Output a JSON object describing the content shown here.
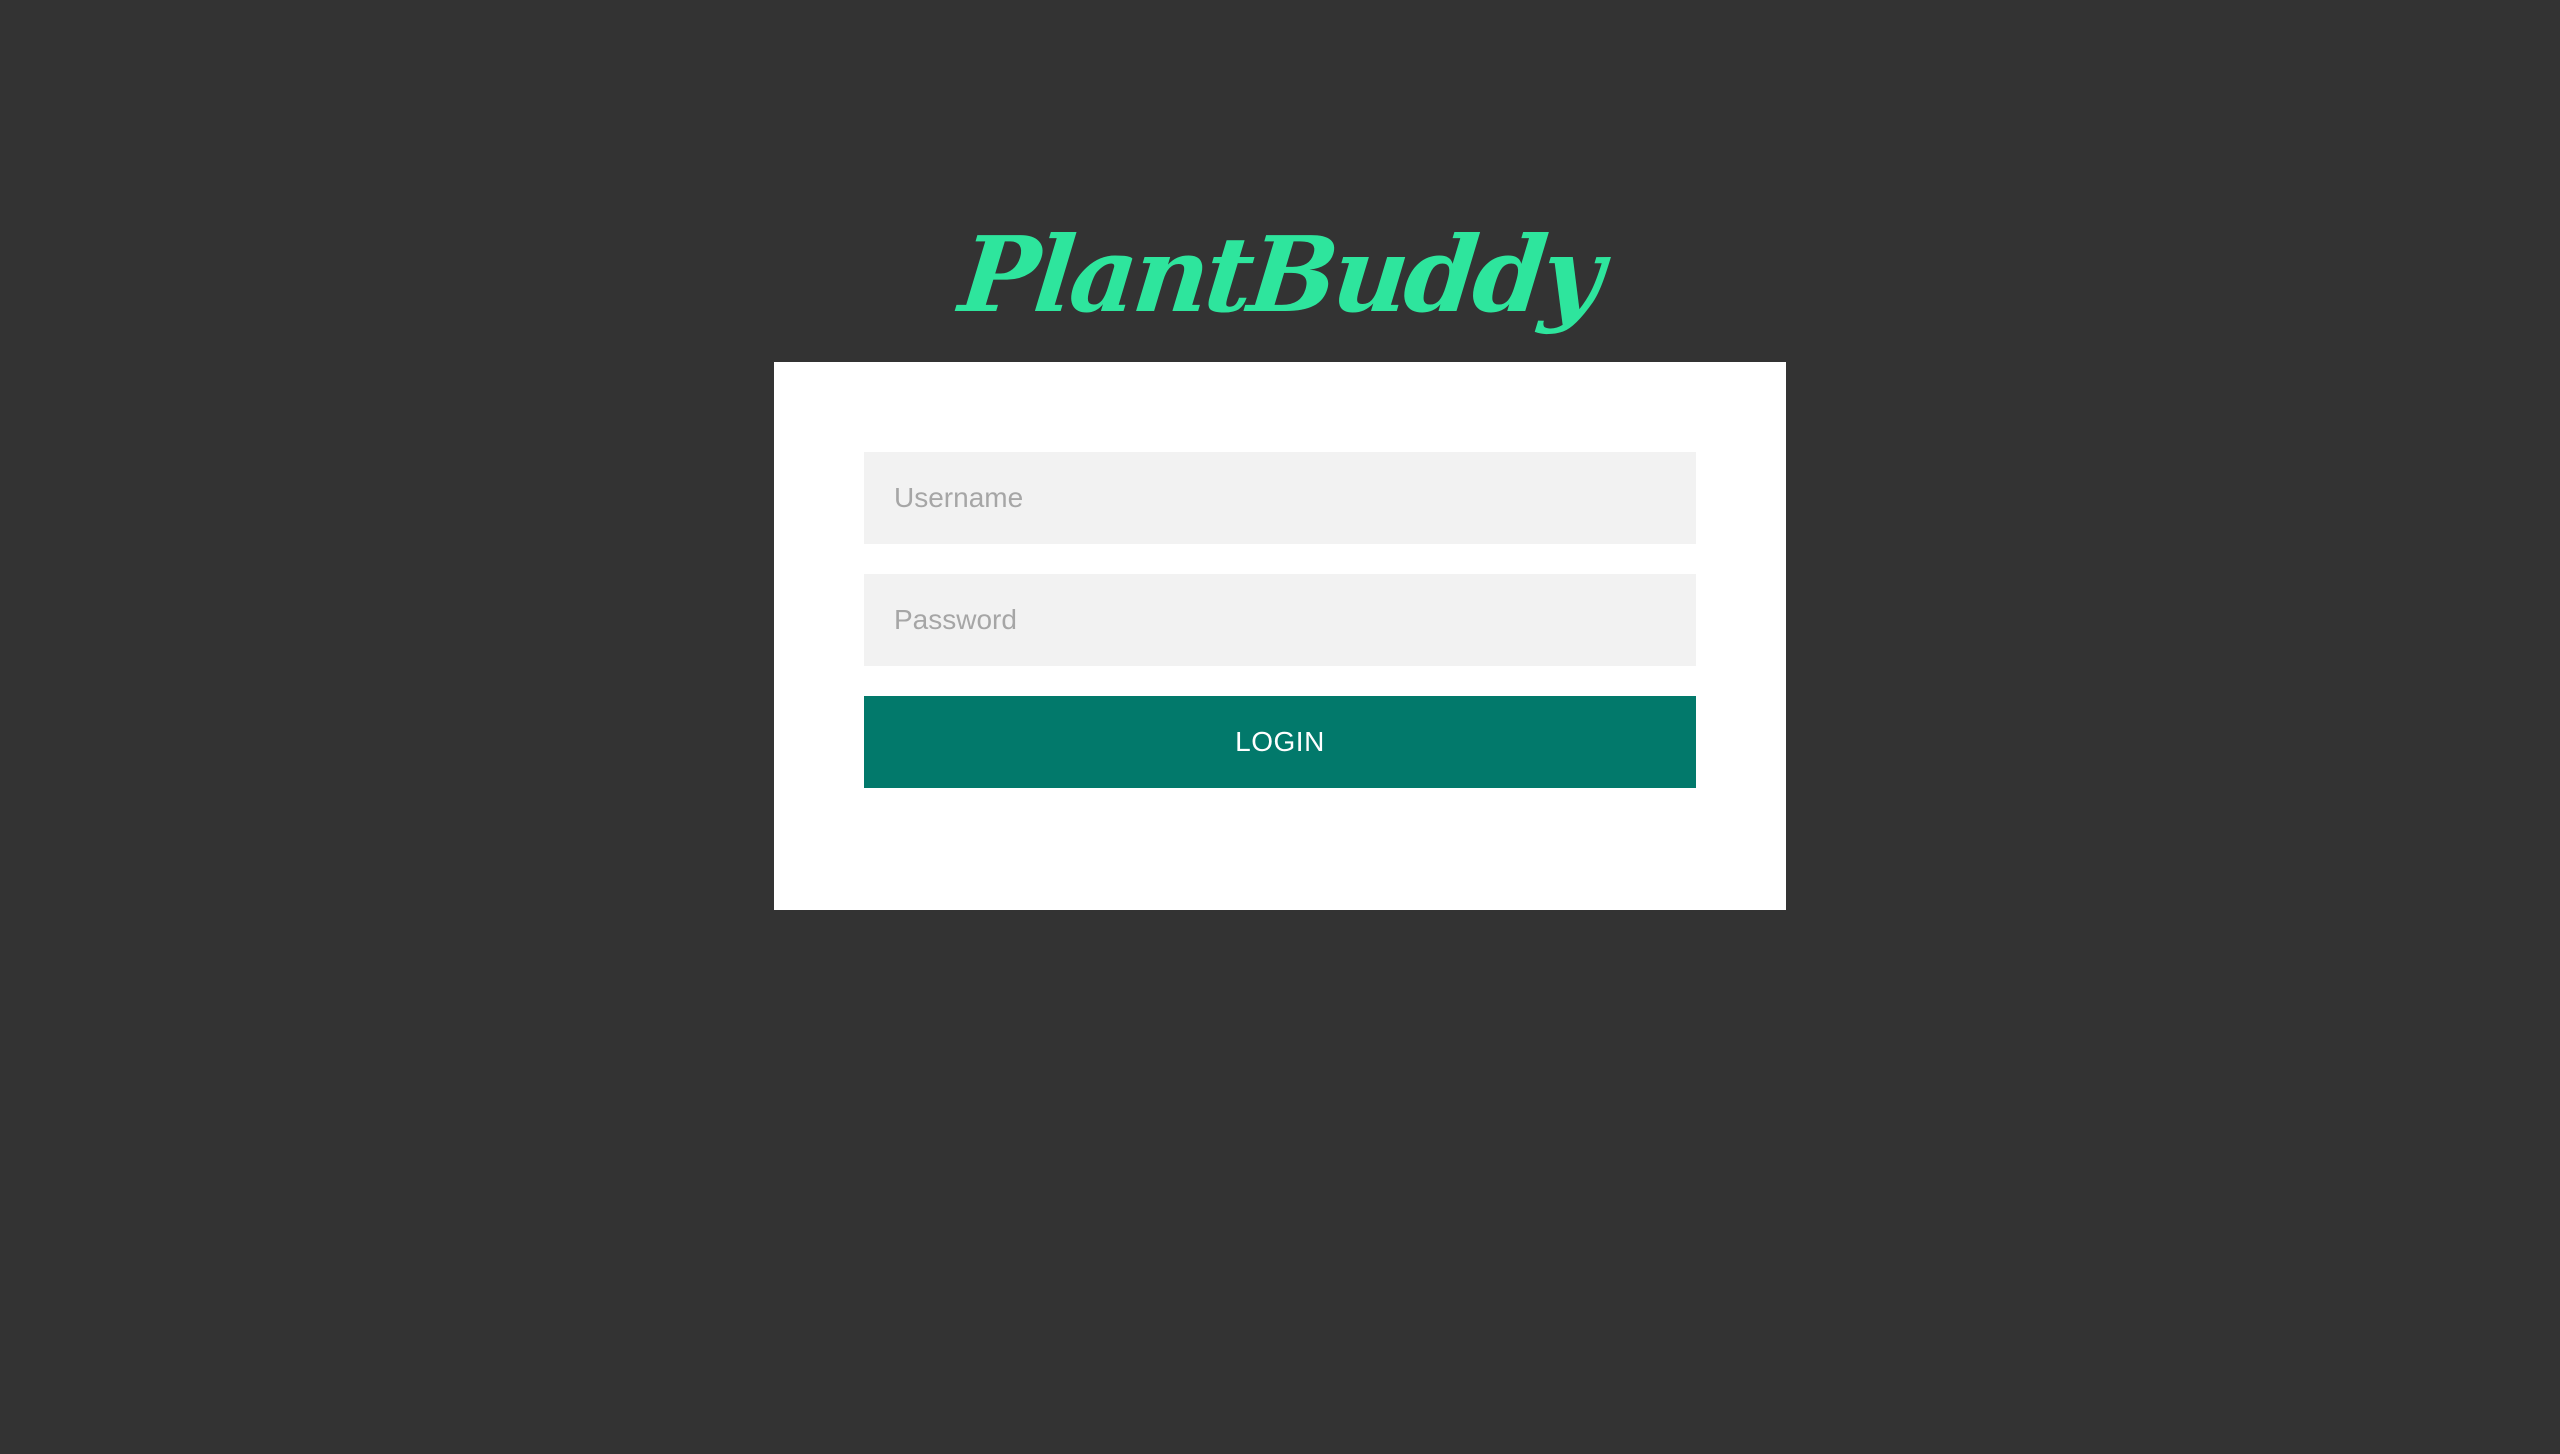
{
  "brand": {
    "logo_text": "PlantBuddy",
    "logo_color": "#2ee59d"
  },
  "login_form": {
    "username_placeholder": "Username",
    "username_value": "",
    "password_placeholder": "Password",
    "password_value": "",
    "login_label": "LOGIN"
  },
  "colors": {
    "background": "#333333",
    "card": "#ffffff",
    "input_background": "#f2f2f2",
    "button": "#02796b",
    "button_text": "#ffffff"
  }
}
